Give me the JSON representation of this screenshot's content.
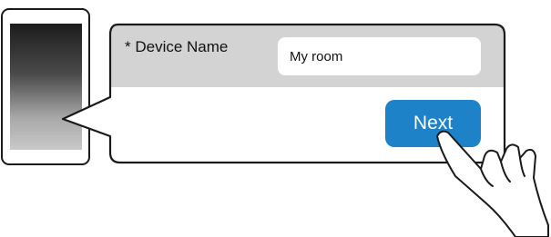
{
  "form": {
    "field_label": "* Device Name",
    "field_value": "My room",
    "next_label": "Next"
  },
  "colors": {
    "button": "#1d82c8",
    "panel_header": "#d3d3d3",
    "outline": "#1a1a1a"
  },
  "icons": {
    "phone": "smartphone-icon",
    "hand": "tapping-hand-icon"
  }
}
